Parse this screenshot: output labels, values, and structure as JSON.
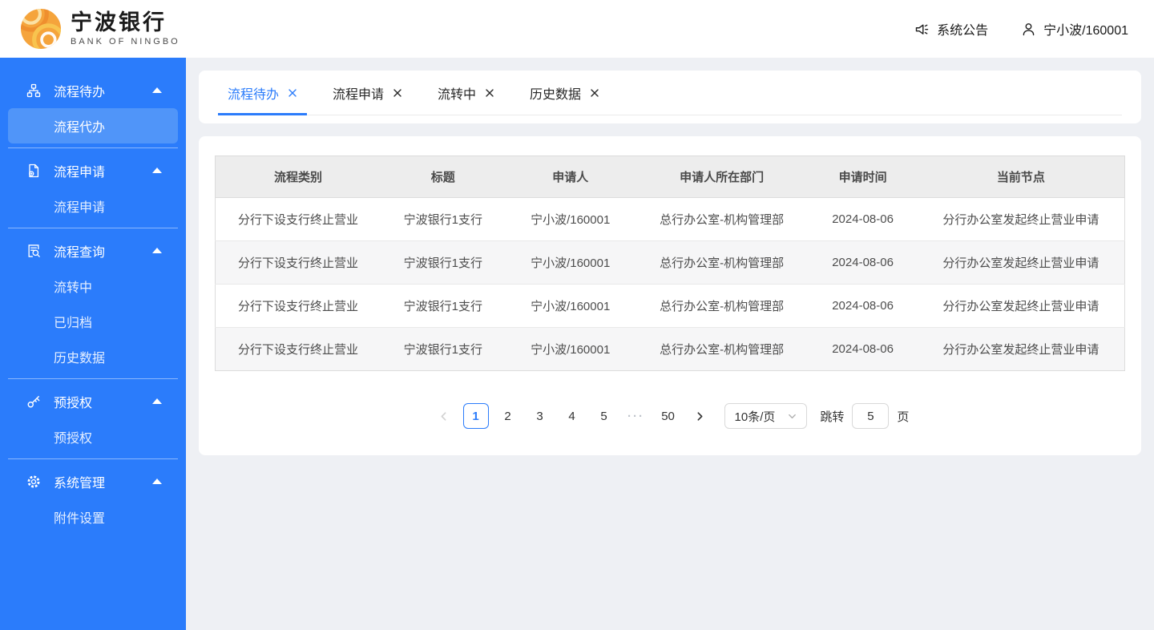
{
  "header": {
    "logo_cn": "宁波银行",
    "logo_en": "BANK OF NINGBO",
    "announcement": "系统公告",
    "user": "宁小波/160001"
  },
  "sidebar": {
    "active_item": "流程代办",
    "groups": [
      {
        "label": "流程待办",
        "icon": "sitemap-icon",
        "items": [
          "流程代办"
        ]
      },
      {
        "label": "流程申请",
        "icon": "document-add-icon",
        "items": [
          "流程申请"
        ]
      },
      {
        "label": "流程查询",
        "icon": "document-search-icon",
        "items": [
          "流转中",
          "已归档",
          "历史数据"
        ]
      },
      {
        "label": "预授权",
        "icon": "key-icon",
        "items": [
          "预授权"
        ]
      },
      {
        "label": "系统管理",
        "icon": "gear-icon",
        "items": [
          "附件设置"
        ]
      }
    ]
  },
  "tabs": [
    {
      "label": "流程待办",
      "active": true
    },
    {
      "label": "流程申请",
      "active": false
    },
    {
      "label": "流转中",
      "active": false
    },
    {
      "label": "历史数据",
      "active": false
    }
  ],
  "table": {
    "headers": [
      "流程类别",
      "标题",
      "申请人",
      "申请人所在部门",
      "申请时间",
      "当前节点"
    ],
    "rows": [
      [
        "分行下设支行终止营业",
        "宁波银行1支行",
        "宁小波/160001",
        "总行办公室-机构管理部",
        "2024-08-06",
        "分行办公室发起终止营业申请"
      ],
      [
        "分行下设支行终止营业",
        "宁波银行1支行",
        "宁小波/160001",
        "总行办公室-机构管理部",
        "2024-08-06",
        "分行办公室发起终止营业申请"
      ],
      [
        "分行下设支行终止营业",
        "宁波银行1支行",
        "宁小波/160001",
        "总行办公室-机构管理部",
        "2024-08-06",
        "分行办公室发起终止营业申请"
      ],
      [
        "分行下设支行终止营业",
        "宁波银行1支行",
        "宁小波/160001",
        "总行办公室-机构管理部",
        "2024-08-06",
        "分行办公室发起终止营业申请"
      ]
    ]
  },
  "pagination": {
    "pages": [
      "1",
      "2",
      "3",
      "4",
      "5",
      "···",
      "50"
    ],
    "active_page": "1",
    "page_size": "10条/页",
    "jump_label": "跳转",
    "jump_value": "5",
    "jump_suffix": "页"
  },
  "colors": {
    "primary_blue": "#2b7cfb",
    "sidebar_active_bg": "#5095f9",
    "logo_orange": "#f5a43c",
    "table_header_bg": "#ededed"
  }
}
